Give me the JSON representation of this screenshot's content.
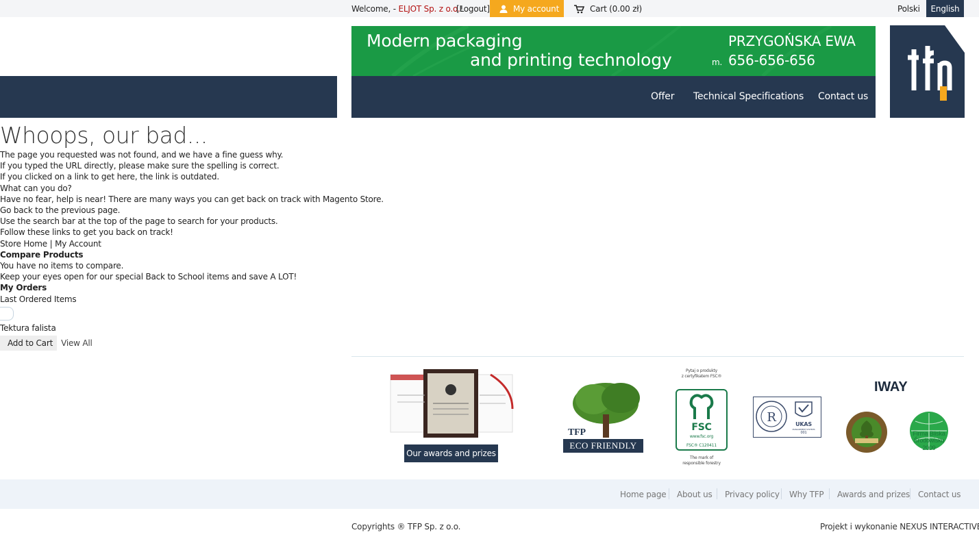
{
  "topbar": {
    "welcome_prefix": "Welcome, - ",
    "company": "ELJOT Sp. z o.o.",
    "welcome_suffix": "!",
    "logout": "[Logout]",
    "my_account": "My account",
    "cart": "Cart (0.00 zł)",
    "lang_pl": "Polski",
    "lang_en": "English"
  },
  "banner": {
    "line1": "Modern packaging",
    "line2": "and printing technology",
    "contact_name": "PRZYGOŃSKA EWA",
    "phone_prefix": "m.",
    "phone": "656-656-656"
  },
  "nav": {
    "offer": "Offer",
    "tech": "Technical Specifications",
    "contact": "Contact us"
  },
  "content": {
    "title": "Whoops, our bad...",
    "lines": [
      "The page you requested was not found, and we have a fine guess why.",
      "If you typed the URL directly, please make sure the spelling is correct.",
      "If you clicked on a link to get here, the link is outdated.",
      "What can you do?",
      "Have no fear, help is near! There are many ways you can get back on track with Magento Store.",
      "Go back to the previous page.",
      "Use the search bar at the top of the page to search for your products.",
      "Follow these links to get you back on track!"
    ],
    "store_home": "Store Home",
    "sep": " | ",
    "my_account_link": "My Account",
    "compare_heading": "Compare Products",
    "compare_empty": "You have no items to compare.",
    "promo": "Keep your eyes open for our special Back to School items and save A LOT!",
    "orders_heading": "My Orders",
    "last_ordered": "Last Ordered Items",
    "product": "Tektura falista",
    "add_to_cart": "Add to Cart",
    "view_all": "View All"
  },
  "awards": {
    "button": "Our awards and prizes",
    "tfp_label": "TFP",
    "eco_label": "ECO FRIENDLY",
    "fsc_top1": "Pytaj o produkty",
    "fsc_top2": "z certyfikatem FSC®",
    "fsc_name": "FSC",
    "fsc_url": "www.fsc.org",
    "fsc_code": "FSC® C120411",
    "fsc_bottom1": "The mark of",
    "fsc_bottom2": "responsible forestry",
    "ukas": "UKAS",
    "ukas_sub": "MANAGEMENT SYSTEMS",
    "ukas_num": "001",
    "iway": "IWAY",
    "seal2_l1": "Firma Bliska",
    "seal2_l2": "Środowisku",
    "seal2_l3": "2009"
  },
  "footer": {
    "links": [
      "Home page",
      "About us",
      "Privacy policy",
      "Why TFP",
      "Awards and prizes",
      "Contact us"
    ],
    "copyright": "Copyrights ® TFP Sp. z o.o.",
    "credit": "Projekt i wykonanie NEXUS INTERACTIVE"
  },
  "colors": {
    "navy": "#263850",
    "green": "#1a9a45",
    "orange": "#f5a81e",
    "company_red": "#b31212"
  }
}
